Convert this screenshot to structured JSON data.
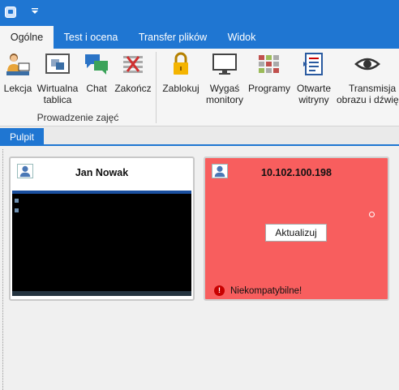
{
  "titlebar": {
    "app_icon": "app-logo-icon",
    "quick_access_icon": "chevron-down-icon"
  },
  "tabs": [
    {
      "label": "Ogólne",
      "active": true
    },
    {
      "label": "Test i ocena"
    },
    {
      "label": "Transfer plików"
    },
    {
      "label": "Widok"
    }
  ],
  "ribbon": {
    "buttons": [
      {
        "label": "Lekcja",
        "icon": "teacher-icon"
      },
      {
        "label": "Wirtualna tablica",
        "label_line1": "Wirtualna",
        "label_line2": "tablica",
        "icon": "whiteboard-icon"
      },
      {
        "label": "Chat",
        "icon": "chat-icon"
      },
      {
        "label": "Zakończ",
        "icon": "end-icon"
      },
      {
        "label": "Zablokuj",
        "icon": "lock-icon"
      },
      {
        "label": "Wygaś monitory",
        "label_line1": "Wygaś",
        "label_line2": "monitory",
        "icon": "monitor-icon"
      },
      {
        "label": "Programy",
        "icon": "programs-icon"
      },
      {
        "label": "Otwarte witryny",
        "label_line1": "Otwarte",
        "label_line2": "witryny",
        "icon": "websites-icon"
      },
      {
        "label": "Transmisja obrazu i dźwięku",
        "label_line1": "Transmisja",
        "label_line2": "obrazu i dźwię",
        "icon": "eye-icon"
      }
    ],
    "group_label": "Prowadzenie zajęć"
  },
  "subtabs": [
    {
      "label": "Pulpit",
      "active": true
    }
  ],
  "computers": [
    {
      "name": "Jan Nowak",
      "status": "online",
      "avatar_icon": "user-icon"
    },
    {
      "name": "10.102.100.198",
      "status": "error",
      "avatar_icon": "user-icon",
      "update_button": "Aktualizuj",
      "error_text": "Niekompatybilne!",
      "error_icon": "exclamation-icon"
    }
  ],
  "colors": {
    "accent": "#1f76d2",
    "error_card": "#f85e5e",
    "error_icon": "#c80000"
  }
}
